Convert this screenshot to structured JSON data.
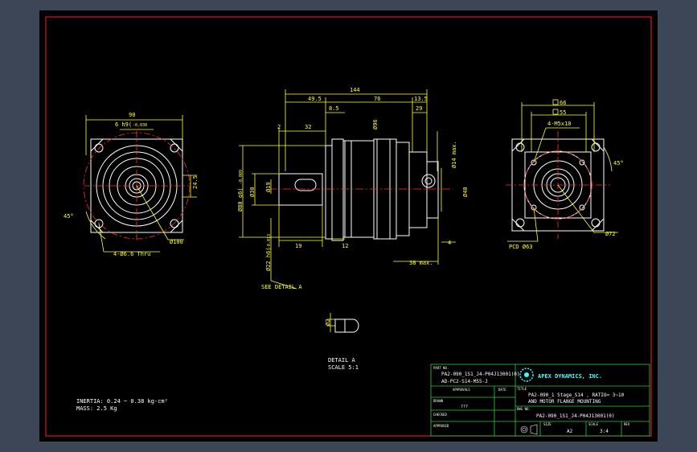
{
  "colors": {
    "background": "#3c4656",
    "viewport": "#000000",
    "border": "#ff2020",
    "geometry": "#ffffff",
    "dimension": "#ffff33",
    "center": "#ff3030",
    "titleblock": "#33cc33",
    "cyan": "#33ffff"
  },
  "front_view": {
    "dims": {
      "width": "90",
      "pcd": "Ø100",
      "hole": "4-Ø6.6 Thru",
      "tolerance_label": "6 h9(",
      "tolerance_value": "-0.030",
      "height": "24.5",
      "angle": "45°"
    }
  },
  "side_view": {
    "dims": {
      "overall": "144",
      "d1": "49.5",
      "d2": "76",
      "d3": "13.5",
      "d4": "8.5",
      "d5": "29",
      "d6": "2",
      "d7": "32",
      "d8": "Ø96",
      "d9": "Ø80 g6(",
      "d10": "Ø30",
      "d11": "Ø19",
      "d12": "Ø22 h6(",
      "d13": "19",
      "d14": "12",
      "d15": "Ø14 max.",
      "d16": "Ø40",
      "d17": "4",
      "d18": "38 max.",
      "tol_a": "-0.009",
      "tol_b": "-0.029",
      "tol_c": "-0.013"
    },
    "callout": "SEE DETAIL A"
  },
  "right_view": {
    "dims": {
      "sq1": "66",
      "sq2": "55",
      "holes": "4-M5x10",
      "pcd": "PCD Ø63",
      "dia": "Ø72",
      "angle": "45°"
    }
  },
  "detail": {
    "dim": "Ø2",
    "title": "DETAIL A",
    "scale": "SCALE 5:1"
  },
  "notes": {
    "line1": "INERTIA: 0.24 ~ 0.38 kg-cm²",
    "line2": "MASS: 2.5  Kg"
  },
  "title_block": {
    "part_no_label": "PART NO.",
    "part_no_line1": "PA2-090_1S1_J4-P04J13001(0)",
    "part_no_line2": "AD-PC2-S14-M55-J",
    "company": "APEX DYNAMICS, INC.",
    "approvals_label": "APPROVALS",
    "date_label": "DATE",
    "title_label": "TITLE",
    "title_line1": "PA2-090_1 Stage_S14 , RATIO= 3~10",
    "title_line2": "AND MOTOR FLANGE MOUNTING",
    "drawn_label": "DRAWN",
    "drawn_value": "???",
    "dwg_no_label": "DWG NO.",
    "dwg_no_value": "PA2-090_1S1_J4-P04J13001(0)",
    "checked_label": "CHECKED",
    "approved_label": "APPROVED",
    "size_label": "SIZE",
    "size_value": "A2",
    "scale_label": "SCALE",
    "scale_value": "3:4",
    "rev_label": "REV"
  }
}
